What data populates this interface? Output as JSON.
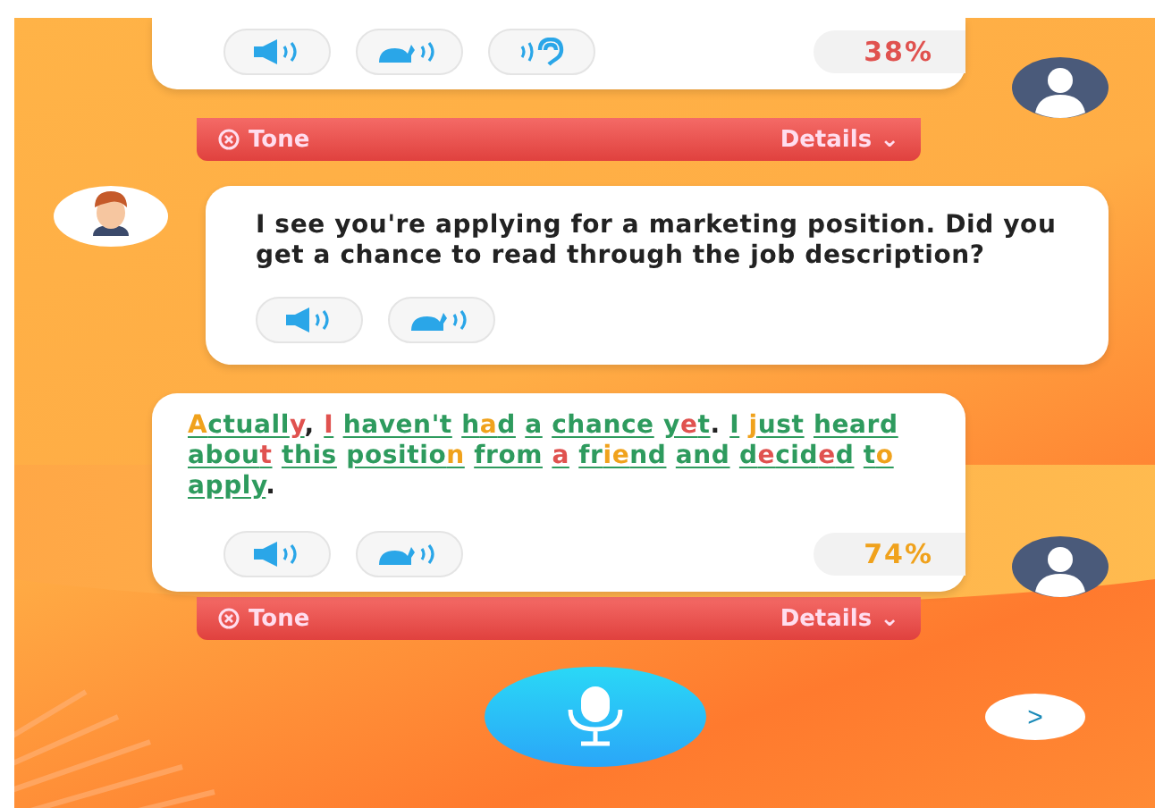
{
  "messages": [
    {
      "kind": "user",
      "buttons": [
        {
          "kind": "speaker"
        },
        {
          "kind": "slow"
        },
        {
          "kind": "ear"
        }
      ],
      "score": "38%",
      "color": "#e0524f",
      "tone": {
        "label": "Tone",
        "details": "Details ⌄"
      }
    },
    {
      "kind": "bot",
      "text": "I see you're applying for a marketing position. Did you get a chance to read through the job description?",
      "buttons": [
        {
          "kind": "speaker"
        },
        {
          "kind": "slow"
        }
      ]
    },
    {
      "kind": "user",
      "buttons": [
        {
          "kind": "speaker"
        },
        {
          "kind": "slow"
        }
      ],
      "score": "74%",
      "color": "#f0a21c",
      "tone": {
        "label": "Tone",
        "details": "Details ⌄"
      },
      "words": [
        {
          "segments": [
            {
              "text": "A",
              "color": "#f0a21c"
            },
            {
              "text": "ctuall",
              "color": "#2e9b5e"
            },
            {
              "text": "y",
              "color": "#e0524f"
            }
          ],
          "trailing": ","
        },
        {
          "segments": [
            {
              "text": "I",
              "color": "#e0524f"
            }
          ]
        },
        {
          "segments": [
            {
              "text": "haven't",
              "color": "#2e9b5e"
            }
          ]
        },
        {
          "segments": [
            {
              "text": "h",
              "color": "#2e9b5e"
            },
            {
              "text": "a",
              "color": "#f0a21c"
            },
            {
              "text": "d",
              "color": "#2e9b5e"
            }
          ]
        },
        {
          "segments": [
            {
              "text": "a",
              "color": "#2e9b5e"
            }
          ]
        },
        {
          "segments": [
            {
              "text": "chance",
              "color": "#2e9b5e"
            }
          ]
        },
        {
          "segments": [
            {
              "text": "y",
              "color": "#2e9b5e"
            },
            {
              "text": "e",
              "color": "#e0524f"
            },
            {
              "text": "t",
              "color": "#2e9b5e"
            }
          ],
          "trailing": "."
        },
        {
          "segments": [
            {
              "text": "I",
              "color": "#2e9b5e"
            }
          ]
        },
        {
          "segments": [
            {
              "text": "j",
              "color": "#f0a21c"
            },
            {
              "text": "ust",
              "color": "#2e9b5e"
            }
          ]
        },
        {
          "segments": [
            {
              "text": "heard",
              "color": "#2e9b5e"
            }
          ]
        },
        {
          "segments": [
            {
              "text": "abou",
              "color": "#2e9b5e"
            },
            {
              "text": "t",
              "color": "#e0524f"
            }
          ]
        },
        {
          "segments": [
            {
              "text": "this",
              "color": "#2e9b5e"
            }
          ]
        },
        {
          "segments": [
            {
              "text": "positio",
              "color": "#2e9b5e"
            },
            {
              "text": "n",
              "color": "#f0a21c"
            }
          ]
        },
        {
          "segments": [
            {
              "text": "from",
              "color": "#2e9b5e"
            }
          ]
        },
        {
          "segments": [
            {
              "text": "a",
              "color": "#e0524f"
            }
          ]
        },
        {
          "segments": [
            {
              "text": "fr",
              "color": "#2e9b5e"
            },
            {
              "text": "ie",
              "color": "#f0a21c"
            },
            {
              "text": "nd",
              "color": "#2e9b5e"
            }
          ]
        },
        {
          "segments": [
            {
              "text": "and",
              "color": "#2e9b5e"
            }
          ]
        },
        {
          "segments": [
            {
              "text": "d",
              "color": "#2e9b5e"
            },
            {
              "text": "e",
              "color": "#e0524f"
            },
            {
              "text": "cid",
              "color": "#2e9b5e"
            },
            {
              "text": "e",
              "color": "#e0524f"
            },
            {
              "text": "d",
              "color": "#2e9b5e"
            }
          ]
        },
        {
          "segments": [
            {
              "text": "t",
              "color": "#2e9b5e"
            },
            {
              "text": "o",
              "color": "#f0a21c"
            }
          ]
        },
        {
          "segments": [
            {
              "text": "apply",
              "color": "#2e9b5e"
            }
          ],
          "trailing": "."
        }
      ]
    }
  ],
  "next_button": ">"
}
